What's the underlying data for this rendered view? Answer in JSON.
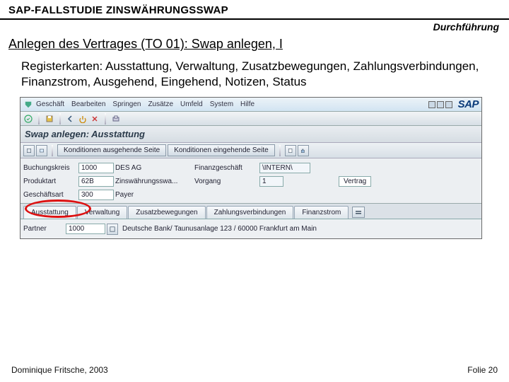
{
  "slide": {
    "title_prefix": "SAP-F",
    "title_rest": "ALLSTUDIE ZINSWÄHRUNGSSWAP",
    "subtitle": "Durchführung",
    "section": "Anlegen des Vertrages (TO 01): Swap anlegen, I",
    "body": "Registerkarten: Ausstattung, Verwaltung, Zusatzbewegungen, Zahlungsverbindungen, Finanzstrom, Ausgehend, Eingehend, Notizen, Status",
    "footer_left": "Dominique Fritsche, 2003",
    "footer_right": "Folie 20"
  },
  "sap": {
    "menubar": [
      "Geschäft",
      "Bearbeiten",
      "Springen",
      "Zusätze",
      "Umfeld",
      "System",
      "Hilfe"
    ],
    "logo": "SAP",
    "screen_title": "Swap anlegen: Ausstattung",
    "subtoolbar": {
      "btn_out": "Konditionen ausgehende Seite",
      "btn_in": "Konditionen eingehende Seite"
    },
    "form": {
      "rows": [
        {
          "label": "Buchungskreis",
          "value": "1000",
          "desc": "DES AG",
          "c2label": "Finanzgeschäft",
          "c2value": "\\INTERN\\",
          "c3label": "",
          "c3value": ""
        },
        {
          "label": "Produktart",
          "value": "62B",
          "desc": "Zinswährungsswa...",
          "c2label": "Vorgang",
          "c2value": "1",
          "c3label": "",
          "c3value": "Vertrag"
        },
        {
          "label": "Geschäftsart",
          "value": "300",
          "desc": "Payer",
          "c2label": "",
          "c2value": "",
          "c3label": "",
          "c3value": ""
        }
      ]
    },
    "tabs": [
      "Ausstattung",
      "Verwaltung",
      "Zusatzbewegungen",
      "Zahlungsverbindungen",
      "Finanzstrom"
    ],
    "detail": {
      "label": "Partner",
      "value": "1000",
      "desc": "Deutsche Bank/ Taunusanlage 123 / 60000 Frankfurt am Main"
    }
  }
}
